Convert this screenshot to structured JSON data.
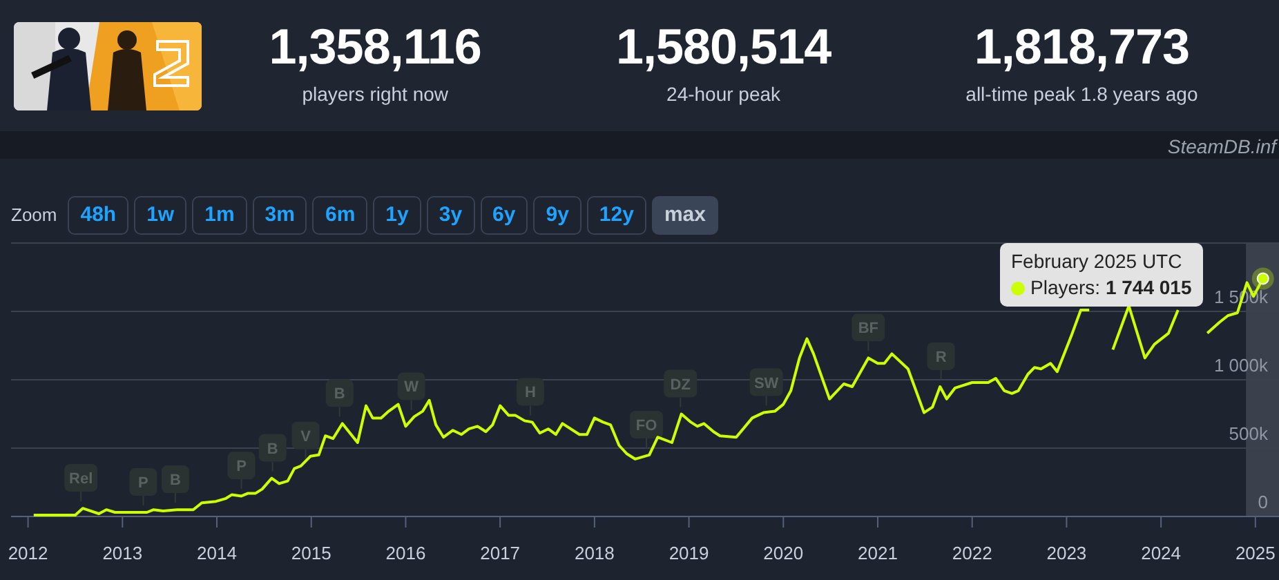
{
  "header": {
    "stats": [
      {
        "value": "1,358,116",
        "label": "players right now"
      },
      {
        "value": "1,580,514",
        "label": "24-hour peak"
      },
      {
        "value": "1,818,773",
        "label": "all-time peak 1.8 years ago"
      }
    ]
  },
  "credit": "SteamDB.inf",
  "zoom": {
    "label": "Zoom",
    "buttons": [
      {
        "label": "48h",
        "selected": false
      },
      {
        "label": "1w",
        "selected": false
      },
      {
        "label": "1m",
        "selected": false
      },
      {
        "label": "3m",
        "selected": false
      },
      {
        "label": "6m",
        "selected": false
      },
      {
        "label": "1y",
        "selected": false
      },
      {
        "label": "3y",
        "selected": false
      },
      {
        "label": "6y",
        "selected": false
      },
      {
        "label": "9y",
        "selected": false
      },
      {
        "label": "12y",
        "selected": false
      },
      {
        "label": "max",
        "selected": true
      }
    ]
  },
  "chart": {
    "chart_data": {
      "type": "line",
      "x": [
        2012.06,
        2012.5,
        2012.58,
        2012.75,
        2012.83,
        2012.92,
        2013.26,
        2013.33,
        2013.43,
        2013.58,
        2013.75,
        2013.84,
        2013.99,
        2014.09,
        2014.16,
        2014.26,
        2014.33,
        2014.41,
        2014.48,
        2014.58,
        2014.66,
        2014.75,
        2014.82,
        2014.89,
        2014.99,
        2015.08,
        2015.15,
        2015.23,
        2015.33,
        2015.49,
        2015.58,
        2015.65,
        2015.74,
        2015.82,
        2015.92,
        2016.0,
        2016.09,
        2016.18,
        2016.25,
        2016.32,
        2016.4,
        2016.5,
        2016.59,
        2016.67,
        2016.76,
        2016.85,
        2016.92,
        2017.0,
        2017.09,
        2017.16,
        2017.26,
        2017.34,
        2017.42,
        2017.51,
        2017.59,
        2017.66,
        2017.84,
        2017.92,
        2018.0,
        2018.09,
        2018.17,
        2018.26,
        2018.34,
        2018.43,
        2018.58,
        2018.67,
        2018.82,
        2018.92,
        2019.02,
        2019.09,
        2019.16,
        2019.26,
        2019.33,
        2019.5,
        2019.67,
        2019.79,
        2019.91,
        2020.0,
        2020.08,
        2020.17,
        2020.25,
        2020.32,
        2020.49,
        2020.64,
        2020.73,
        2020.9,
        2021.0,
        2021.07,
        2021.15,
        2021.32,
        2021.49,
        2021.58,
        2021.66,
        2021.73,
        2021.82,
        2022.0,
        2022.17,
        2022.25,
        2022.34,
        2022.42,
        2022.49,
        2022.59,
        2022.66,
        2022.73,
        2022.83,
        2022.9,
        2023.05,
        2023.15,
        2023.24,
        2023.32,
        2023.41,
        2023.49,
        2023.66,
        2023.83,
        2023.93,
        2024.08,
        2024.18,
        2024.32,
        2024.49,
        2024.62,
        2024.71,
        2024.81,
        2024.91,
        2024.98,
        2025.08
      ],
      "series": [
        {
          "color": "#ccff00",
          "values": [
            10000,
            10000,
            60000,
            20000,
            50000,
            30000,
            30000,
            50000,
            40000,
            50000,
            50000,
            100000,
            110000,
            130000,
            160000,
            150000,
            170000,
            170000,
            200000,
            280000,
            240000,
            260000,
            350000,
            370000,
            440000,
            450000,
            590000,
            570000,
            680000,
            540000,
            810000,
            720000,
            720000,
            770000,
            820000,
            660000,
            730000,
            770000,
            850000,
            670000,
            580000,
            630000,
            600000,
            640000,
            660000,
            620000,
            670000,
            810000,
            740000,
            740000,
            700000,
            690000,
            610000,
            640000,
            600000,
            680000,
            600000,
            600000,
            720000,
            690000,
            670000,
            520000,
            460000,
            420000,
            450000,
            580000,
            540000,
            750000,
            690000,
            660000,
            680000,
            620000,
            590000,
            580000,
            720000,
            760000,
            770000,
            820000,
            920000,
            1160000,
            1300000,
            1190000,
            860000,
            970000,
            950000,
            1160000,
            1120000,
            1120000,
            1190000,
            1080000,
            760000,
            800000,
            950000,
            860000,
            940000,
            980000,
            980000,
            1010000,
            920000,
            900000,
            920000,
            1040000,
            1090000,
            1080000,
            1120000,
            1060000,
            1320000,
            1510000,
            1510000,
            null,
            null,
            1220000,
            1540000,
            1160000,
            1260000,
            1340000,
            1510000,
            null,
            1340000,
            1420000,
            1470000,
            1490000,
            1710000,
            1610000,
            1740000
          ]
        }
      ],
      "xlim": [
        2011.82,
        2025.25
      ],
      "ylim": [
        0,
        2000000
      ],
      "grid": true,
      "xticks": [
        2012,
        2013,
        2014,
        2015,
        2016,
        2017,
        2018,
        2019,
        2020,
        2021,
        2022,
        2023,
        2024,
        2025
      ],
      "yticks": [
        {
          "value": 0,
          "label": "0"
        },
        {
          "value": 500000,
          "label": "500k"
        },
        {
          "value": 1000000,
          "label": "1 000k"
        },
        {
          "value": 1500000,
          "label": "1 500k"
        }
      ],
      "bands": [
        {
          "axis": "x",
          "from": 2024.9,
          "to": 2025.25
        }
      ],
      "annotations": [
        {
          "x": 2012.56,
          "text": "Rel"
        },
        {
          "x": 2013.22,
          "text": "P"
        },
        {
          "x": 2013.56,
          "text": "B"
        },
        {
          "x": 2014.26,
          "text": "P"
        },
        {
          "x": 2014.59,
          "text": "B"
        },
        {
          "x": 2014.94,
          "text": "V"
        },
        {
          "x": 2015.3,
          "text": "B"
        },
        {
          "x": 2016.06,
          "text": "W"
        },
        {
          "x": 2017.32,
          "text": "H"
        },
        {
          "x": 2018.55,
          "text": "FO"
        },
        {
          "x": 2018.91,
          "text": "DZ"
        },
        {
          "x": 2019.82,
          "text": "SW"
        },
        {
          "x": 2020.9,
          "text": "BF"
        },
        {
          "x": 2021.67,
          "text": "R"
        }
      ]
    },
    "tooltip": {
      "title": "February 2025 UTC",
      "text": "Players: **1 744 015**"
    }
  }
}
